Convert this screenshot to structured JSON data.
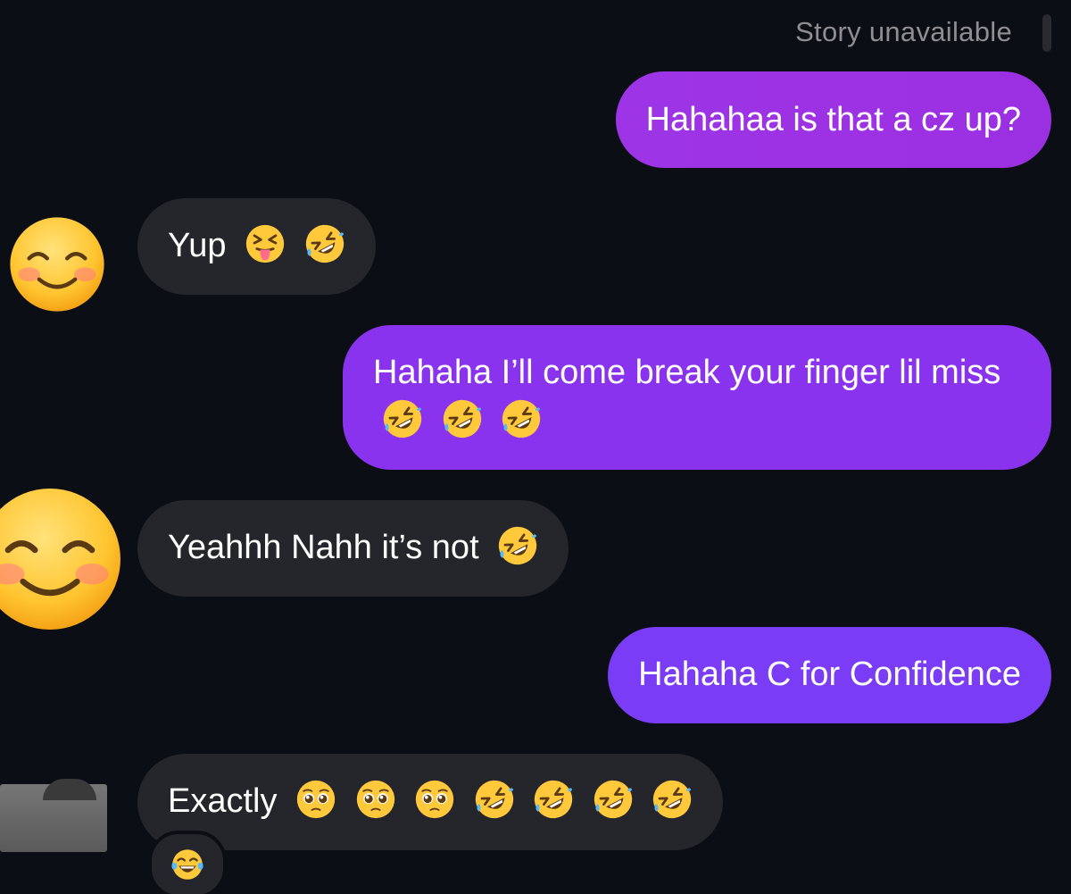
{
  "header": {
    "story_note": "Story unavailable"
  },
  "messages": [
    {
      "side": "out",
      "text": "Hahahaa is that a cz up?",
      "emojis": []
    },
    {
      "side": "in",
      "text": "Yup",
      "emojis": [
        "squinting-tongue-emoji",
        "rofl-emoji"
      ]
    },
    {
      "side": "out",
      "text": "Hahaha I’ll come break your finger lil miss",
      "emojis": [
        "rofl-emoji",
        "rofl-emoji",
        "rofl-emoji"
      ]
    },
    {
      "side": "in",
      "text": "Yeahhh Nahh it’s not",
      "emojis": [
        "rofl-emoji"
      ]
    },
    {
      "side": "out",
      "text": "Hahaha C for Confidence",
      "emojis": []
    },
    {
      "side": "in",
      "text": "Exactly",
      "emojis": [
        "pleading-emoji",
        "pleading-emoji",
        "pleading-emoji",
        "rofl-emoji",
        "rofl-emoji",
        "rofl-emoji",
        "rofl-emoji"
      ]
    }
  ],
  "reaction": {
    "icon": "tears-of-joy-emoji"
  },
  "colors": {
    "background": "#0c0e15",
    "incoming_bubble": "#25262b",
    "outgoing_top": "#9d34e6",
    "outgoing_mid": "#8a33ee",
    "outgoing_bottom": "#7a3cf5"
  }
}
